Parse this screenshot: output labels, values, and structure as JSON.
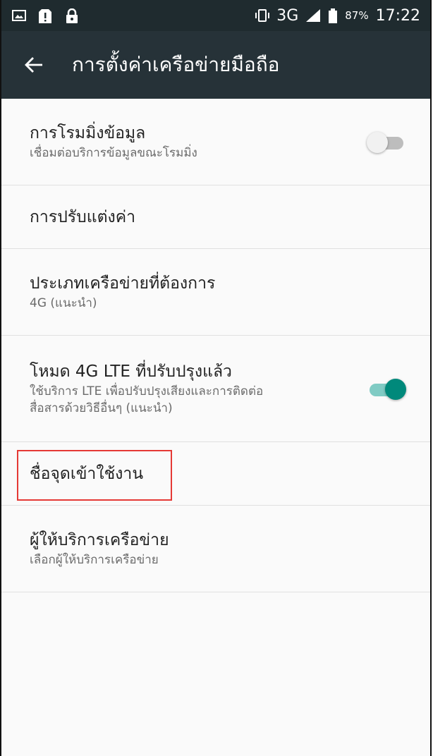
{
  "status_bar": {
    "network": "3G",
    "battery_percent": "87%",
    "time": "17:22",
    "icons": [
      "screenshot-icon",
      "sim-alert-icon",
      "lock-icon",
      "vibrate-icon",
      "signal-icon",
      "battery-icon"
    ]
  },
  "app_bar": {
    "title": "การตั้งค่าเครือข่ายมือถือ"
  },
  "settings": [
    {
      "title": "การโรมมิ่งข้อมูล",
      "subtitle": "เชื่อมต่อบริการข้อมูลขณะโรมมิ่ง",
      "toggle": false
    },
    {
      "title": "การปรับแต่งค่า"
    },
    {
      "title": "ประเภทเครือข่ายที่ต้องการ",
      "subtitle": "4G (แนะนำ)"
    },
    {
      "title": "โหมด 4G LTE ที่ปรับปรุงแล้ว",
      "subtitle_line1": "ใช้บริการ LTE เพื่อปรับปรุงเสียงและการติดต่อ",
      "subtitle_line2": "สื่อสารด้วยวิธีอื่นๆ (แนะนำ)",
      "toggle": true
    },
    {
      "title": "ชื่อจุดเข้าใช้งาน",
      "highlighted": true
    },
    {
      "title": "ผู้ให้บริการเครือข่าย",
      "subtitle": "เลือกผู้ให้บริการเครือข่าย"
    }
  ],
  "colors": {
    "status_bar": "#1f2b2f",
    "app_bar": "#263238",
    "toggle_on_thumb": "#00897b",
    "toggle_on_track": "#80cbc4",
    "toggle_off_thumb": "#f1f1f1",
    "toggle_off_track": "#bdbdbd",
    "highlight": "#e53935"
  }
}
